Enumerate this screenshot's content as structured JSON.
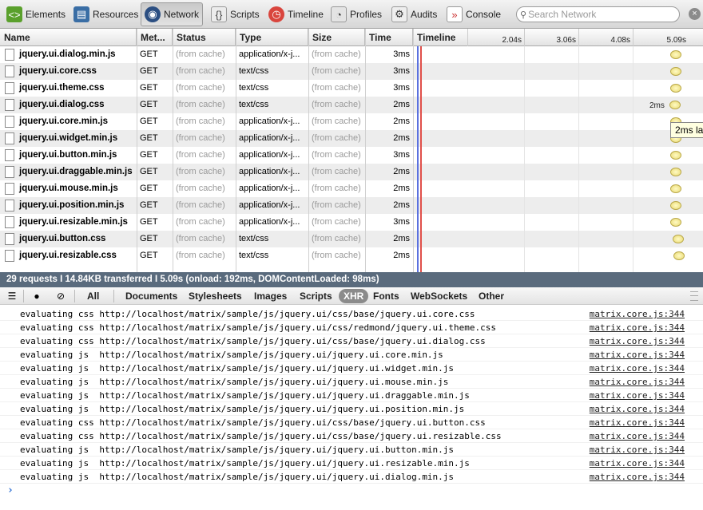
{
  "toolbar": {
    "items": [
      {
        "label": "Elements",
        "icon": "elements-icon"
      },
      {
        "label": "Resources",
        "icon": "resources-icon"
      },
      {
        "label": "Network",
        "icon": "network-icon",
        "selected": true
      },
      {
        "label": "Scripts",
        "icon": "scripts-icon"
      },
      {
        "label": "Timeline",
        "icon": "timeline-icon"
      },
      {
        "label": "Profiles",
        "icon": "profiles-icon"
      },
      {
        "label": "Audits",
        "icon": "audits-icon"
      },
      {
        "label": "Console",
        "icon": "console-icon"
      }
    ],
    "search_placeholder": "Search Network",
    "close_glyph": "×"
  },
  "network": {
    "columns": {
      "name": "Name",
      "method": "Met...",
      "status": "Status",
      "type": "Type",
      "size": "Size",
      "time": "Time",
      "timeline": "Timeline"
    },
    "ticks": [
      "2.04s",
      "3.06s",
      "4.08s",
      "5.09s"
    ],
    "rows": [
      {
        "name": "jquery.ui.dialog.min.js",
        "method": "GET",
        "status": "(from cache)",
        "type": "application/x-j...",
        "size": "(from cache)",
        "time": "3ms"
      },
      {
        "name": "jquery.ui.core.css",
        "method": "GET",
        "status": "(from cache)",
        "type": "text/css",
        "size": "(from cache)",
        "time": "3ms"
      },
      {
        "name": "jquery.ui.theme.css",
        "method": "GET",
        "status": "(from cache)",
        "type": "text/css",
        "size": "(from cache)",
        "time": "3ms"
      },
      {
        "name": "jquery.ui.dialog.css",
        "method": "GET",
        "status": "(from cache)",
        "type": "text/css",
        "size": "(from cache)",
        "time": "2ms"
      },
      {
        "name": "jquery.ui.core.min.js",
        "method": "GET",
        "status": "(from cache)",
        "type": "application/x-j...",
        "size": "(from cache)",
        "time": "2ms"
      },
      {
        "name": "jquery.ui.widget.min.js",
        "method": "GET",
        "status": "(from cache)",
        "type": "application/x-j...",
        "size": "(from cache)",
        "time": "2ms"
      },
      {
        "name": "jquery.ui.button.min.js",
        "method": "GET",
        "status": "(from cache)",
        "type": "application/x-j...",
        "size": "(from cache)",
        "time": "3ms"
      },
      {
        "name": "jquery.ui.draggable.min.js",
        "method": "GET",
        "status": "(from cache)",
        "type": "application/x-j...",
        "size": "(from cache)",
        "time": "2ms"
      },
      {
        "name": "jquery.ui.mouse.min.js",
        "method": "GET",
        "status": "(from cache)",
        "type": "application/x-j...",
        "size": "(from cache)",
        "time": "2ms"
      },
      {
        "name": "jquery.ui.position.min.js",
        "method": "GET",
        "status": "(from cache)",
        "type": "application/x-j...",
        "size": "(from cache)",
        "time": "2ms"
      },
      {
        "name": "jquery.ui.resizable.min.js",
        "method": "GET",
        "status": "(from cache)",
        "type": "application/x-j...",
        "size": "(from cache)",
        "time": "3ms"
      },
      {
        "name": "jquery.ui.button.css",
        "method": "GET",
        "status": "(from cache)",
        "type": "text/css",
        "size": "(from cache)",
        "time": "2ms"
      },
      {
        "name": "jquery.ui.resizable.css",
        "method": "GET",
        "status": "(from cache)",
        "type": "text/css",
        "size": "(from cache)",
        "time": "2ms"
      }
    ],
    "bar_label": "2ms",
    "tooltip": "2ms la"
  },
  "summary": "29 requests  I  14.84KB transferred  I  5.09s (onload: 192ms, DOMContentLoaded: 98ms)",
  "console_filters": [
    "All",
    "Documents",
    "Stylesheets",
    "Images",
    "Scripts",
    "XHR",
    "Fonts",
    "WebSockets",
    "Other"
  ],
  "console_active_filter": "XHR",
  "console": [
    {
      "text": "evaluating css http://localhost/matrix/sample/js/jquery.ui/css/base/jquery.ui.core.css",
      "source": "matrix.core.js:344"
    },
    {
      "text": "evaluating css http://localhost/matrix/sample/js/jquery.ui/css/redmond/jquery.ui.theme.css",
      "source": "matrix.core.js:344"
    },
    {
      "text": "evaluating css http://localhost/matrix/sample/js/jquery.ui/css/base/jquery.ui.dialog.css",
      "source": "matrix.core.js:344"
    },
    {
      "text": "evaluating js  http://localhost/matrix/sample/js/jquery.ui/jquery.ui.core.min.js",
      "source": "matrix.core.js:344"
    },
    {
      "text": "evaluating js  http://localhost/matrix/sample/js/jquery.ui/jquery.ui.widget.min.js",
      "source": "matrix.core.js:344"
    },
    {
      "text": "evaluating js  http://localhost/matrix/sample/js/jquery.ui/jquery.ui.mouse.min.js",
      "source": "matrix.core.js:344"
    },
    {
      "text": "evaluating js  http://localhost/matrix/sample/js/jquery.ui/jquery.ui.draggable.min.js",
      "source": "matrix.core.js:344"
    },
    {
      "text": "evaluating js  http://localhost/matrix/sample/js/jquery.ui/jquery.ui.position.min.js",
      "source": "matrix.core.js:344"
    },
    {
      "text": "evaluating css http://localhost/matrix/sample/js/jquery.ui/css/base/jquery.ui.button.css",
      "source": "matrix.core.js:344"
    },
    {
      "text": "evaluating css http://localhost/matrix/sample/js/jquery.ui/css/base/jquery.ui.resizable.css",
      "source": "matrix.core.js:344"
    },
    {
      "text": "evaluating js  http://localhost/matrix/sample/js/jquery.ui/jquery.ui.button.min.js",
      "source": "matrix.core.js:344"
    },
    {
      "text": "evaluating js  http://localhost/matrix/sample/js/jquery.ui/jquery.ui.resizable.min.js",
      "source": "matrix.core.js:344"
    },
    {
      "text": "evaluating js  http://localhost/matrix/sample/js/jquery.ui/jquery.ui.dialog.min.js",
      "source": "matrix.core.js:344"
    }
  ],
  "console_prompt": "›",
  "colors": {
    "summary_bar": "#5a6b7d",
    "load_line": "#e0504a",
    "dom_line": "#5b72e0",
    "link": "#222222"
  }
}
